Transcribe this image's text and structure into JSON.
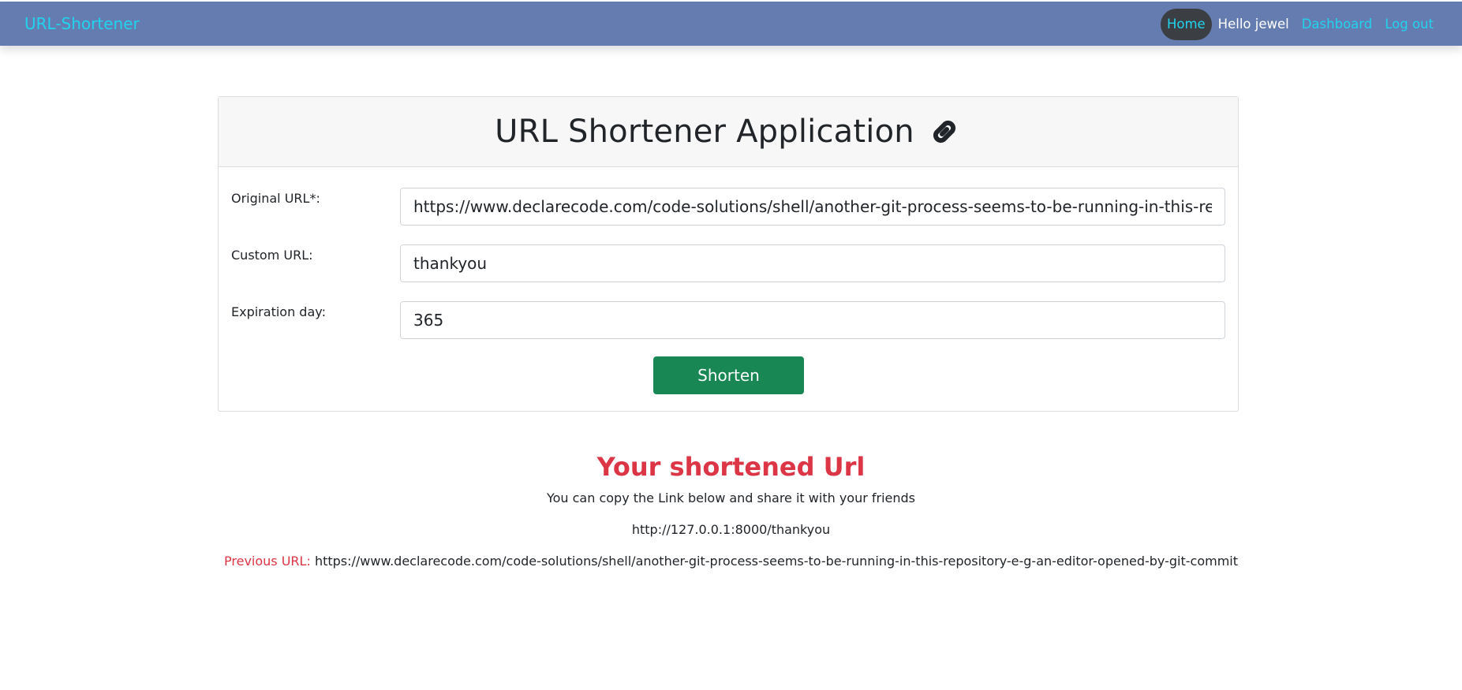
{
  "navbar": {
    "brand": "URL-Shortener",
    "home": "Home",
    "greeting": "Hello jewel",
    "dashboard": "Dashboard",
    "logout": "Log out"
  },
  "card": {
    "title": "URL Shortener Application",
    "icon": "link-icon",
    "fields": {
      "original_label": "Original URL*:",
      "original_value": "https://www.declarecode.com/code-solutions/shell/another-git-process-seems-to-be-running-in-this-repository-e-g-an-editor-opened-by-git-commit",
      "custom_label": "Custom URL:",
      "custom_value": "thankyou",
      "expiration_label": "Expiration day:",
      "expiration_value": "365"
    },
    "shorten_label": "Shorten"
  },
  "result": {
    "title": "Your shortened Url",
    "subtitle": "You can copy the Link below and share it with your friends",
    "short_url": "http://127.0.0.1:8000/thankyou",
    "previous_label": "Previous URL:",
    "previous_url": "https://www.declarecode.com/code-solutions/shell/another-git-process-seems-to-be-running-in-this-repository-e-g-an-editor-opened-by-git-commit"
  },
  "colors": {
    "navbar_bg": "#647cb0",
    "link": "#22d3ee",
    "success": "#198754",
    "danger": "#dc3545"
  }
}
